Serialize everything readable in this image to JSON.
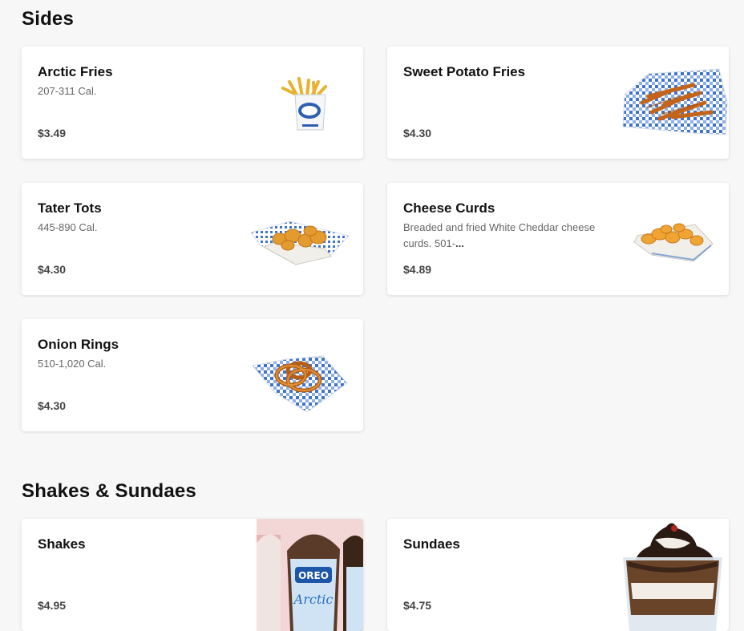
{
  "sections": [
    {
      "title": "Sides",
      "items": [
        {
          "name": "Arctic Fries",
          "desc": "207-311 Cal.",
          "price": "$3.49",
          "image": "fries-bag-image"
        },
        {
          "name": "Sweet Potato Fries",
          "desc": "",
          "price": "$4.30",
          "image": "sweet-potato-fries-basket-image"
        },
        {
          "name": "Tater Tots",
          "desc": "445-890 Cal.",
          "price": "$4.30",
          "image": "tater-tots-tray-image"
        },
        {
          "name": "Cheese Curds",
          "desc": "Breaded and fried White Cheddar cheese curds. 501-",
          "desc_more": "...",
          "price": "$4.89",
          "image": "cheese-curds-tray-image"
        },
        {
          "name": "Onion Rings",
          "desc": "510-1,020 Cal.",
          "price": "$4.30",
          "image": "onion-rings-basket-image"
        }
      ]
    },
    {
      "title": "Shakes & Sundaes",
      "items": [
        {
          "name": "Shakes",
          "desc": "",
          "price": "$4.95",
          "image": "shakes-cups-image",
          "image_text": "OREO",
          "image_text_2": "Arctic"
        },
        {
          "name": "Sundaes",
          "desc": "",
          "price": "$4.75",
          "image": "sundae-cup-image"
        }
      ]
    }
  ],
  "colors": {
    "page_bg": "#f7f7f7",
    "card_bg": "#ffffff",
    "basket_check": "#3f74c9",
    "fried_food": "#d77a1f"
  }
}
